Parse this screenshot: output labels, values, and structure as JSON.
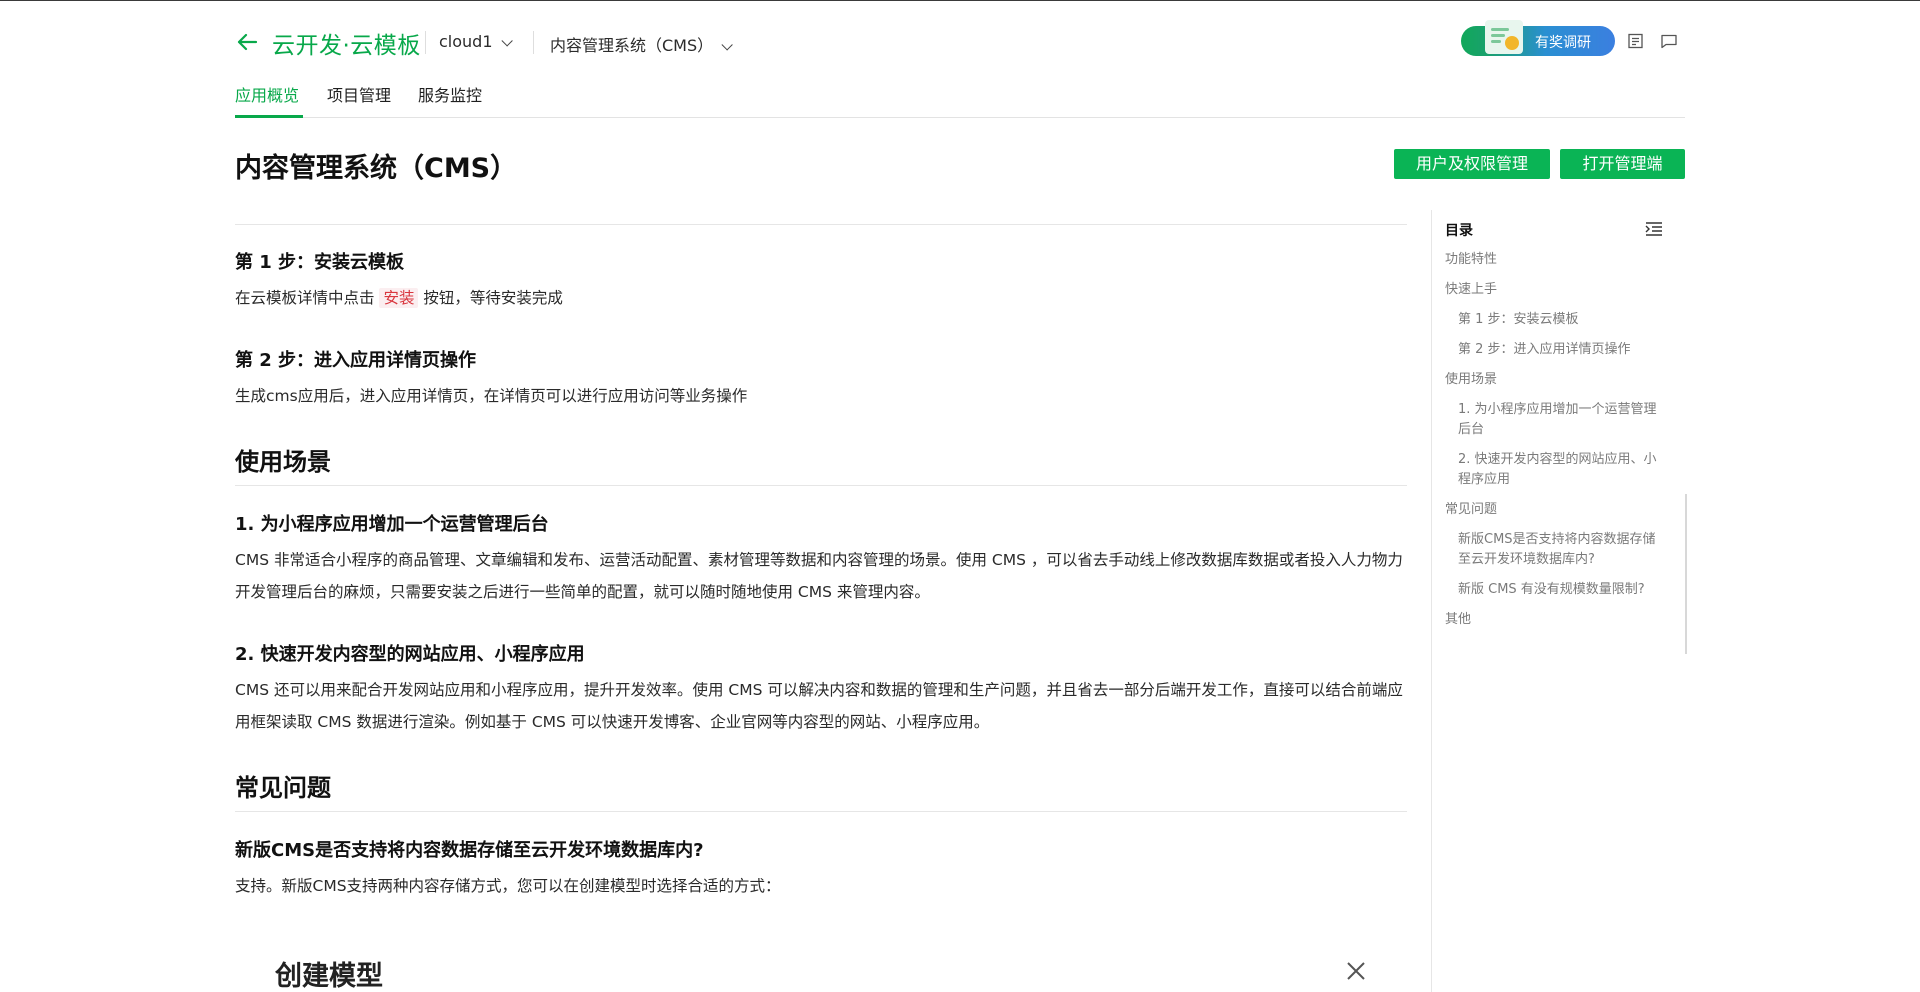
{
  "header": {
    "app_title": "云开发·云模板",
    "env_dropdown": "cloud1",
    "app_dropdown": "内容管理系统（CMS）",
    "survey_label": "有奖调研"
  },
  "tabs": [
    {
      "label": "应用概览",
      "active": true
    },
    {
      "label": "项目管理",
      "active": false
    },
    {
      "label": "服务监控",
      "active": false
    }
  ],
  "page": {
    "title": "内容管理系统（CMS）",
    "buttons": {
      "user_permissions": "用户及权限管理",
      "open_admin": "打开管理端"
    }
  },
  "content": {
    "step1_title": "第 1 步：安装云模板",
    "step1_text_before": "在云模板详情中点击",
    "step1_code": "安装",
    "step1_text_after": "按钮，等待安装完成",
    "step2_title": "第 2 步：进入应用详情页操作",
    "step2_text": "生成cms应用后，进入应用详情页，在详情页可以进行应用访问等业务操作",
    "section_usage": "使用场景",
    "usage1_title": "1. 为小程序应用增加一个运营管理后台",
    "usage1_text": "CMS 非常适合小程序的商品管理、文章编辑和发布、运营活动配置、素材管理等数据和内容管理的场景。使用 CMS ，可以省去手动线上修改数据库数据或者投入人力物力开发管理后台的麻烦，只需要安装之后进行一些简单的配置，就可以随时随地使用 CMS 来管理内容。",
    "usage2_title": "2. 快速开发内容型的网站应用、小程序应用",
    "usage2_text": "CMS 还可以用来配合开发网站应用和小程序应用，提升开发效率。使用 CMS 可以解决内容和数据的管理和生产问题，并且省去一部分后端开发工作，直接可以结合前端应用框架读取 CMS 数据进行渲染。例如基于 CMS 可以快速开发博客、企业官网等内容型的网站、小程序应用。",
    "section_faq": "常见问题",
    "faq1_title": "新版CMS是否支持将内容数据存储至云开发环境数据库内?",
    "faq1_text": "支持。新版CMS支持两种内容存储方式，您可以在创建模型时选择合适的方式：",
    "card_title": "创建模型"
  },
  "toc": {
    "title": "目录",
    "items": [
      {
        "label": "功能特性",
        "level": 1
      },
      {
        "label": "快速上手",
        "level": 1
      },
      {
        "label": "第 1 步：安装云模板",
        "level": 2
      },
      {
        "label": "第 2 步：进入应用详情页操作",
        "level": 2
      },
      {
        "label": "使用场景",
        "level": 1
      },
      {
        "label": "1. 为小程序应用增加一个运营管理后台",
        "level": 2
      },
      {
        "label": "2. 快速开发内容型的网站应用、小程序应用",
        "level": 2
      },
      {
        "label": "常见问题",
        "level": 1
      },
      {
        "label": "新版CMS是否支持将内容数据存储至云开发环境数据库内?",
        "level": 2
      },
      {
        "label": "新版 CMS 有没有规模数量限制?",
        "level": 2
      },
      {
        "label": "其他",
        "level": 1
      }
    ]
  },
  "colors": {
    "brand_green": "#08a84a",
    "button_green": "#0ab455",
    "code_red": "#d9363e"
  }
}
